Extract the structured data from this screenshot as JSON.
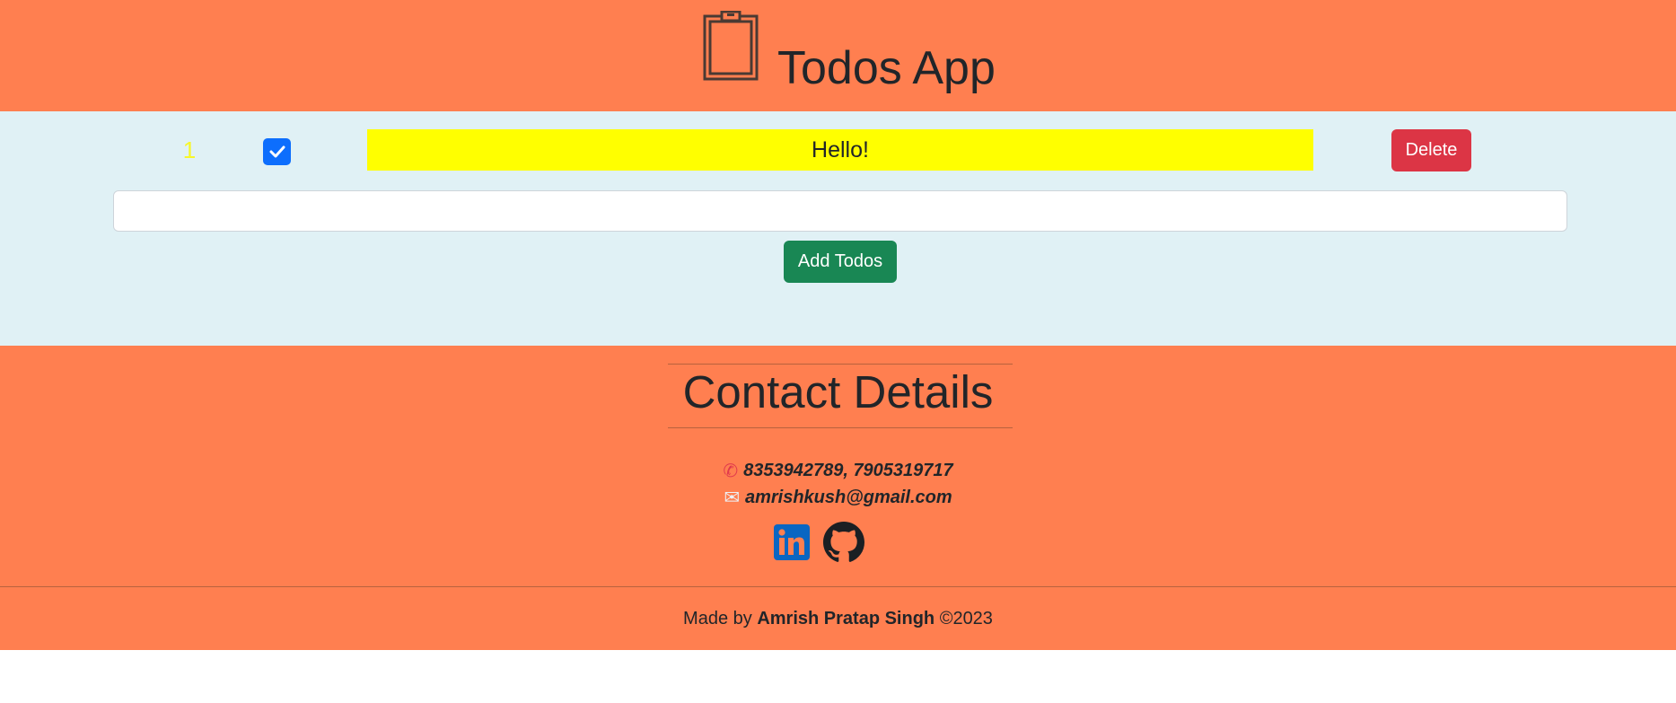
{
  "header": {
    "icon": "clipboard-icon",
    "title": "Todos App"
  },
  "todos": {
    "items": [
      {
        "number": "1",
        "checked": true,
        "text": "Hello!",
        "delete_label": "Delete"
      }
    ],
    "input": {
      "value": "",
      "placeholder": ""
    },
    "add_label": "Add Todos"
  },
  "contact": {
    "title": "Contact Details",
    "phone_icon": "phone-icon",
    "phone": "8353942789, 7905319717",
    "email_icon": "envelope-icon",
    "email": "amrishkush@gmail.com",
    "socials": [
      "linkedin-icon",
      "github-icon"
    ]
  },
  "footer": {
    "prefix": "Made by",
    "author": "Amrish Pratap Singh",
    "copyright": "©2023"
  },
  "colors": {
    "header_bg": "#ff7f50",
    "todos_bg": "#e0f1f5",
    "todo_highlight": "#ffff00",
    "delete": "#dc3545",
    "add": "#198754",
    "checkbox": "#0d6efd"
  }
}
